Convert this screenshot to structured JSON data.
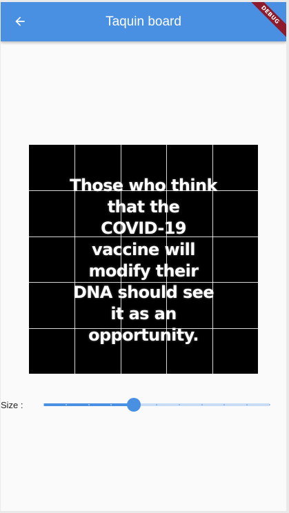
{
  "app_bar": {
    "title": "Taquin board",
    "back_icon": "arrow-back-icon",
    "color": "#4a90e2"
  },
  "debug_banner": {
    "label": "DEBUG",
    "color": "#8e1b2b"
  },
  "board": {
    "rows": 5,
    "columns": 5,
    "image_text_lines": [
      "Those who think",
      "that the",
      "COVID-19",
      "vaccine will",
      "modify their",
      "DNA should see",
      "it as an",
      "opportunity."
    ]
  },
  "size_control": {
    "label": "Size :",
    "min": 0,
    "max": 10,
    "value": 4,
    "divisions": 10,
    "active_color": "#4a90e2",
    "inactive_color": "#c9dcf5"
  }
}
